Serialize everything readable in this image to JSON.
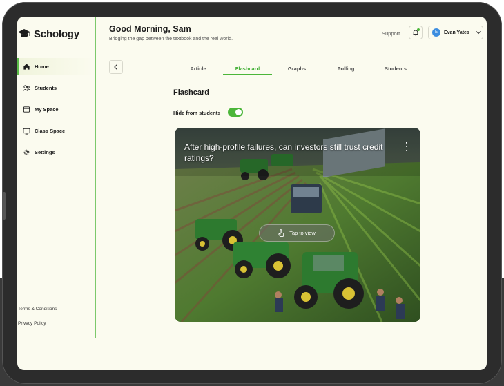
{
  "brand": {
    "name": "Schology"
  },
  "sidebar": {
    "items": [
      {
        "label": "Home",
        "icon": "home-icon",
        "active": true
      },
      {
        "label": "Students",
        "icon": "students-icon",
        "active": false
      },
      {
        "label": "My Space",
        "icon": "my-space-icon",
        "active": false
      },
      {
        "label": "Class Space",
        "icon": "class-space-icon",
        "active": false
      },
      {
        "label": "Settings",
        "icon": "gear-icon",
        "active": false
      }
    ],
    "footer": {
      "terms": "Terms & Conditions",
      "privacy": "Privacy Policy"
    }
  },
  "header": {
    "greeting": "Good Morning, Sam",
    "subtitle": "Bridging the gap between the textbook and the real world.",
    "support": "Support",
    "user": {
      "name": "Evan Yates",
      "initial": "E"
    }
  },
  "tabs": [
    {
      "label": "Article",
      "active": false
    },
    {
      "label": "Flashcard",
      "active": true
    },
    {
      "label": "Graphs",
      "active": false
    },
    {
      "label": "Polling",
      "active": false
    },
    {
      "label": "Students",
      "active": false
    }
  ],
  "main": {
    "section_title": "Flashcard",
    "toggle_label": "Hide from students",
    "toggle_on": true
  },
  "card": {
    "question": "After high-profile failures, can investors still trust credit ratings?",
    "tap_label": "Tap to view",
    "image_icon": "farm-tractors-image"
  },
  "colors": {
    "accent": "#4cb63a",
    "background": "#fbfbef",
    "avatar": "#3c8de0"
  }
}
